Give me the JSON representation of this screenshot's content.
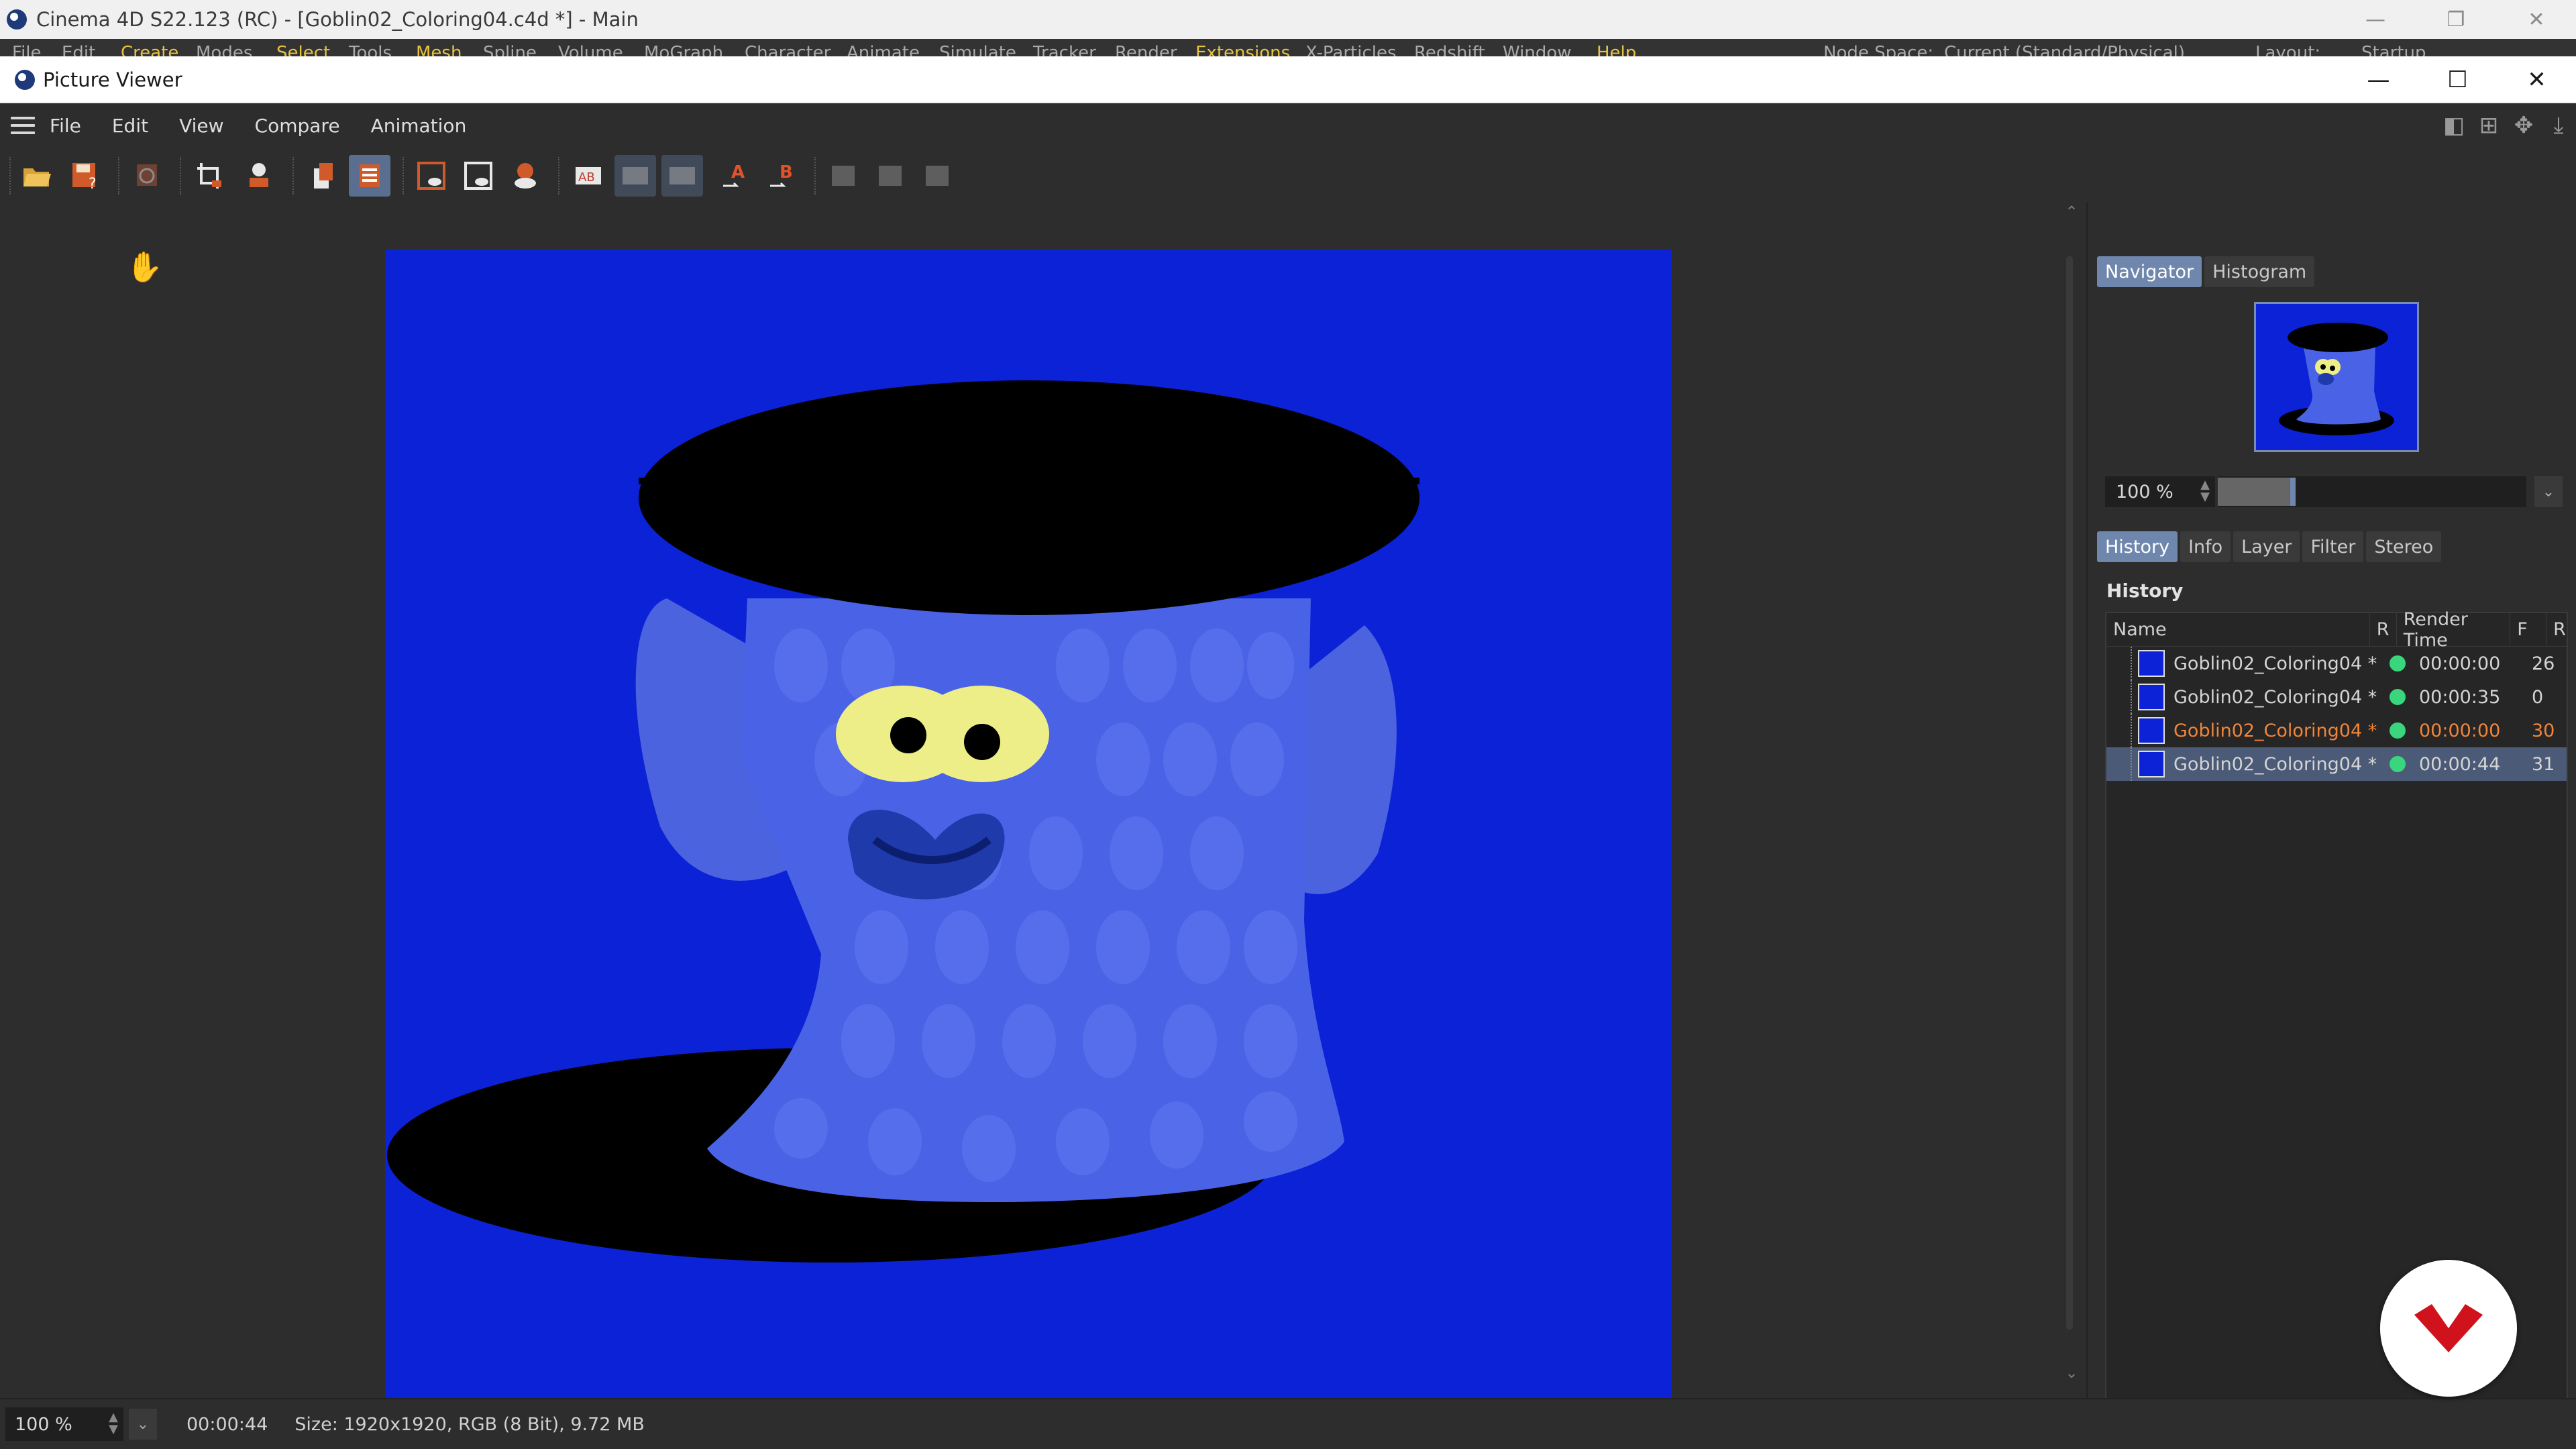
{
  "app": {
    "title": "Cinema 4D S22.123 (RC) - [Goblin02_Coloring04.c4d *] - Main",
    "behind_menu": [
      "File",
      "Edit",
      "Create",
      "Modes",
      "Select",
      "Tools",
      "Mesh",
      "Spline",
      "Volume",
      "MoGraph",
      "Character",
      "Animate",
      "Simulate",
      "Tracker",
      "Render",
      "Extensions",
      "X-Particles",
      "Redshift",
      "Window",
      "Help"
    ],
    "node_space_label": "Node Space:",
    "node_space_value": "Current (Standard/Physical)",
    "layout_label": "Layout:",
    "layout_value": "Startup"
  },
  "picture_viewer": {
    "title": "Picture Viewer",
    "menu": [
      "File",
      "Edit",
      "View",
      "Compare",
      "Animation"
    ],
    "toolbar_icons": [
      "open-icon",
      "save-icon",
      "stop-render-icon",
      "crop-icon",
      "magnifier-icon",
      "copy-icon",
      "list-icon",
      "render-region-icon",
      "render-view-icon",
      "render-all-icon",
      "ab-compare-icon",
      "ab-split-icon",
      "ab-swap-icon",
      "set-a-icon",
      "set-b-icon",
      "grid1-icon",
      "grid2-icon",
      "grid3-icon"
    ],
    "set_a_label": "A",
    "set_b_label": "B",
    "ab_label": "AB"
  },
  "side_panel": {
    "tabs_top": [
      "Navigator",
      "Histogram"
    ],
    "zoom": "100 %",
    "tabs_bottom": [
      "History",
      "Info",
      "Layer",
      "Filter",
      "Stereo"
    ],
    "history_title": "History",
    "columns": {
      "name": "Name",
      "r": "R",
      "render_time": "Render Time",
      "f": "F",
      "r2": "R"
    },
    "rows": [
      {
        "name": "Goblin02_Coloring04 *",
        "time": "00:00:00",
        "frame": "26",
        "state": "normal"
      },
      {
        "name": "Goblin02_Coloring04 *",
        "time": "00:00:35",
        "frame": "0",
        "state": "normal"
      },
      {
        "name": "Goblin02_Coloring04 *",
        "time": "00:00:00",
        "frame": "30",
        "state": "highlight"
      },
      {
        "name": "Goblin02_Coloring04 *",
        "time": "00:00:44",
        "frame": "31",
        "state": "selected"
      }
    ]
  },
  "statusbar": {
    "zoom": "100 %",
    "time": "00:00:44",
    "info": "Size: 1920x1920, RGB (8 Bit), 9.72 MB"
  },
  "colors": {
    "render_background": "#0c22d6",
    "creature": "#4a63e6",
    "accent_selected": "#6f86ad",
    "status_green": "#3ad67e",
    "highlight_orange": "#f0853a"
  }
}
